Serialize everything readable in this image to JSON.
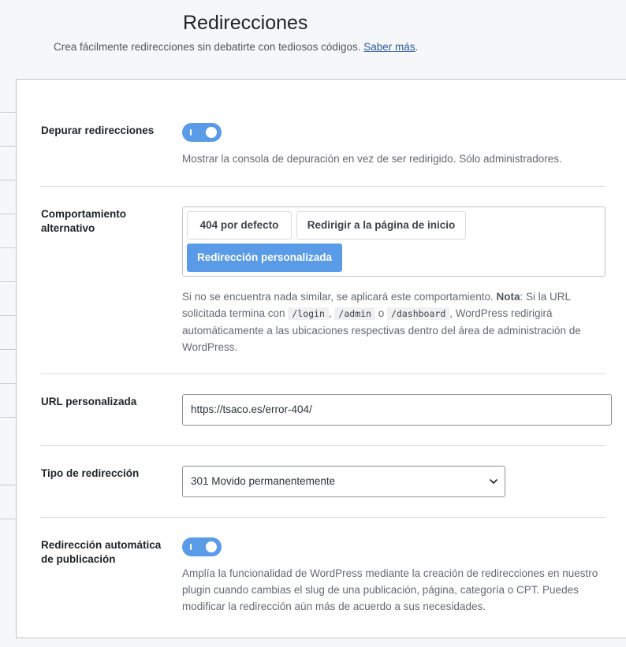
{
  "header": {
    "title": "Redirecciones",
    "description": "Crea fácilmente redirecciones sin debatirte con tediosos códigos.",
    "learn_more": "Saber más",
    "period": "."
  },
  "settings": {
    "debug": {
      "label": "Depurar redirecciones",
      "enabled": true,
      "description": "Mostrar la consola de depuración en vez de ser redirigido. Sólo administradores."
    },
    "fallback": {
      "label": "Comportamiento alternativo",
      "options": [
        "404 por defecto",
        "Redirigir a la página de inicio",
        "Redirección personalizada"
      ],
      "selected": "Redirección personalizada",
      "desc_part1": "Si no se encuentra nada similar, se aplicará este comportamiento.",
      "note_label": "Nota",
      "desc_part2": ": Si la URL solicitada termina con",
      "code1": "/login",
      "comma": ",",
      "code2": "/admin",
      "or": "o",
      "code3": "/dashboard",
      "desc_part3": ", WordPress redirigirá automáticamente a las ubicaciones respectivas dentro del área de administración de WordPress."
    },
    "custom_url": {
      "label": "URL personalizada",
      "value": "https://tsaco.es/error-404/"
    },
    "redirect_type": {
      "label": "Tipo de redirección",
      "selected": "301 Movido permanentemente"
    },
    "auto_redirect": {
      "label": "Redirección automática de publicación",
      "enabled": true,
      "description": "Amplía la funcionalidad de WordPress mediante la creación de redirecciones en nuestro plugin cuando cambias el slug de una publicación, página, categoría o CPT. Puedes modificar la redirección aún más de acuerdo a sus necesidades."
    }
  },
  "icons": {
    "toggle": "toggle-switch-icon",
    "select_arrow": "chevron-down-icon"
  },
  "colors": {
    "accent": "#5a9be8",
    "link": "#2c5a9e"
  }
}
